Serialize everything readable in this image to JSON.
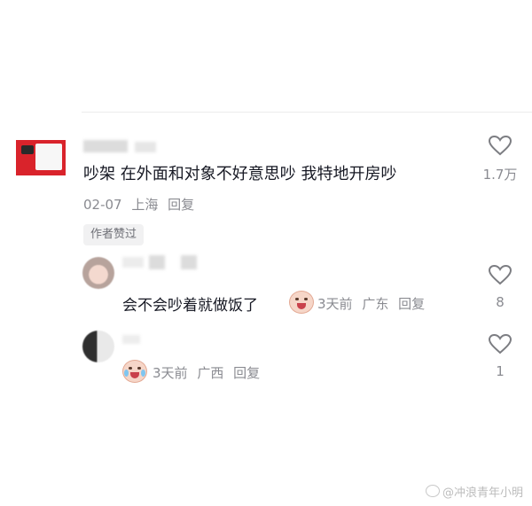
{
  "comment": {
    "text": "吵架 在外面和对象不好意思吵 我特地开房吵",
    "date": "02-07",
    "location": "上海",
    "reply_label": "回复",
    "like_count": "1.7万",
    "author_liked_badge": "作者赞过"
  },
  "replies": [
    {
      "text": "会不会吵着就做饭了",
      "emoji": "hand-over-mouth-emoji",
      "time": "3天前",
      "location": "广东",
      "reply_label": "回复",
      "like_count": "8"
    },
    {
      "text": "",
      "emoji": "crying-emoji",
      "time": "3天前",
      "location": "广西",
      "reply_label": "回复",
      "like_count": "1"
    }
  ],
  "watermark": "@冲浪青年小明",
  "colors": {
    "primary_text": "#161823",
    "secondary_text": "#8a8b91",
    "badge_bg": "#f1f1f2"
  },
  "icons": [
    "heart-outline-icon"
  ]
}
